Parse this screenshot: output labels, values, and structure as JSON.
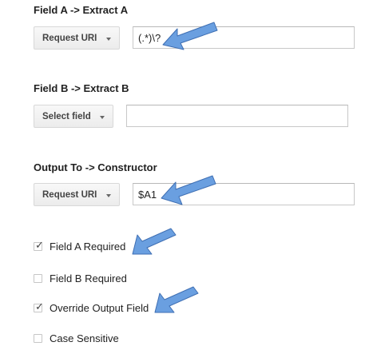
{
  "field_a": {
    "title": "Field A -> Extract A",
    "select_label": "Request URI",
    "input_value": "(.*)\\?",
    "icon": "chevron-down-icon"
  },
  "field_b": {
    "title": "Field B -> Extract B",
    "select_label": "Select field",
    "input_value": "",
    "icon": "chevron-down-icon"
  },
  "output": {
    "title": "Output To -> Constructor",
    "select_label": "Request URI",
    "input_value": "$A1",
    "icon": "chevron-down-icon"
  },
  "checkboxes": [
    {
      "label": "Field A Required",
      "checked": true
    },
    {
      "label": "Field B Required",
      "checked": false
    },
    {
      "label": "Override Output Field",
      "checked": true
    },
    {
      "label": "Case Sensitive",
      "checked": false
    }
  ],
  "check_glyph": "✓",
  "colors": {
    "arrow_fill": "#6a9fe0",
    "arrow_stroke": "#3f6fb3"
  }
}
